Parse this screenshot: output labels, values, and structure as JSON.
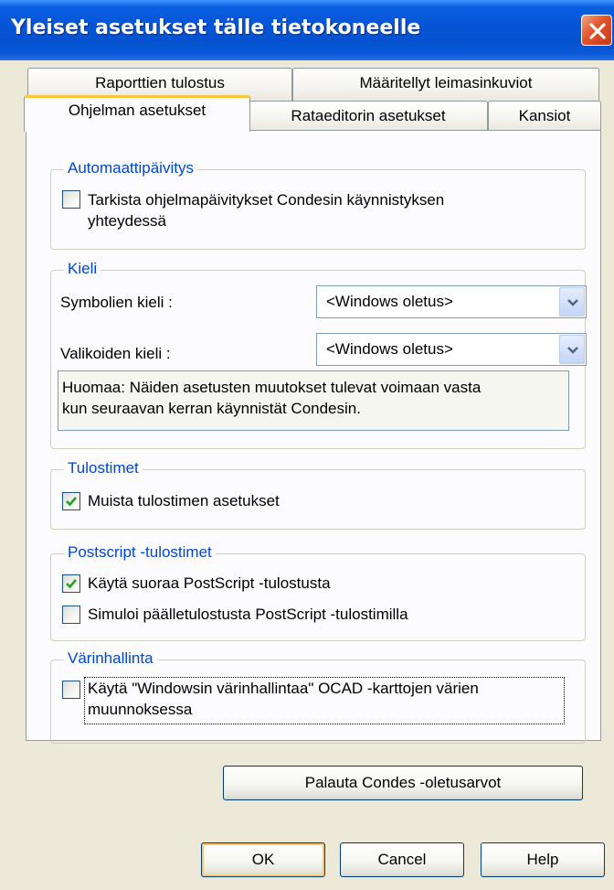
{
  "window": {
    "title": "Yleiset asetukset tälle tietokoneelle"
  },
  "tabs": {
    "row1": [
      "Raporttien tulostus",
      "Määritellyt leimasinkuviot"
    ],
    "row2": [
      "Ohjelman asetukset",
      "Rataeditorin asetukset",
      "Kansiot"
    ],
    "active": "Ohjelman asetukset"
  },
  "auto_update": {
    "legend": "Automaattipäivitys",
    "check_label_line1": "Tarkista ohjelmapäivitykset Condesin käynnistyksen",
    "check_label_line2": "yhteydessä",
    "checked": false
  },
  "language": {
    "legend": "Kieli",
    "symbol_label": "Symbolien kieli :",
    "symbol_value": "<Windows oletus>",
    "menu_label": "Valikoiden kieli :",
    "menu_value": "<Windows oletus>",
    "note_line1": "Huomaa: Näiden asetusten muutokset tulevat voimaan vasta",
    "note_line2": "kun seuraavan kerran käynnistät Condesin."
  },
  "printers": {
    "legend": "Tulostimet",
    "remember_label": "Muista tulostimen asetukset",
    "remember_checked": true
  },
  "postscript": {
    "legend": "Postscript -tulostimet",
    "direct_label": "Käytä suoraa PostScript -tulostusta",
    "direct_checked": true,
    "overprint_label": "Simuloi päälletulostusta PostScript -tulostimilla",
    "overprint_checked": false
  },
  "color_mgmt": {
    "legend": "Värinhallinta",
    "use_label_line1": "Käytä \"Windowsin värinhallintaa\" OCAD -karttojen värien",
    "use_label_line2": "muunnoksessa",
    "use_checked": false
  },
  "reset_button": "Palauta Condes -oletusarvot",
  "buttons": {
    "ok": "OK",
    "cancel": "Cancel",
    "help": "Help"
  },
  "colors": {
    "title_bar": "#0655d6",
    "legend_text": "#0046d5",
    "active_tab_accent": "#ffc83c",
    "check_mark": "#21a121",
    "close_button": "#e3522a"
  }
}
